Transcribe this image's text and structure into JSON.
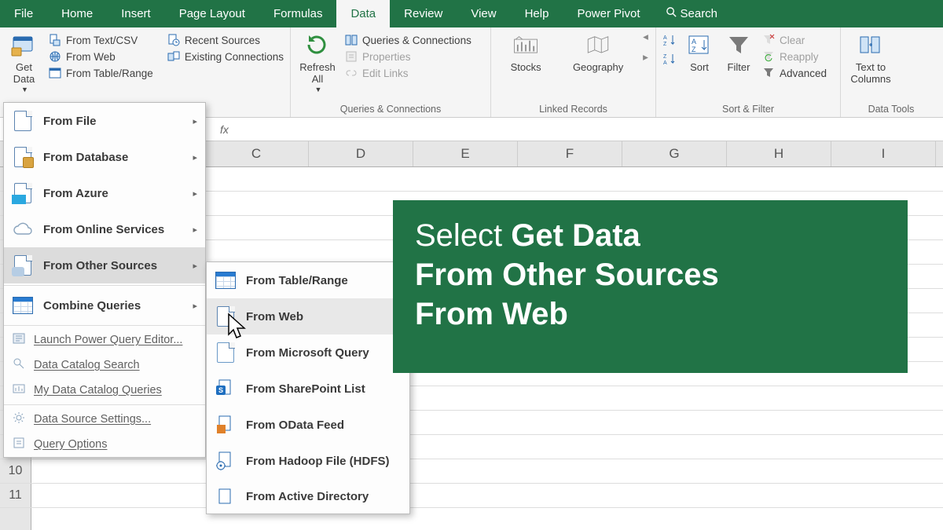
{
  "tabs": [
    "File",
    "Home",
    "Insert",
    "Page Layout",
    "Formulas",
    "Data",
    "Review",
    "View",
    "Help",
    "Power Pivot"
  ],
  "active_tab": "Data",
  "search_label": "Search",
  "ribbon": {
    "get_data": {
      "label": "Get\nData"
    },
    "gt_group": {
      "from_text_csv": "From Text/CSV",
      "from_web": "From Web",
      "from_table_range": "From Table/Range",
      "recent_sources": "Recent Sources",
      "existing_connections": "Existing Connections"
    },
    "refresh_all": {
      "label": "Refresh\nAll"
    },
    "qc_group": {
      "queries_connections": "Queries & Connections",
      "properties": "Properties",
      "edit_links": "Edit Links",
      "label": "Queries & Connections"
    },
    "linked": {
      "stocks": "Stocks",
      "geography": "Geography",
      "label": "Linked Records"
    },
    "sortfilter": {
      "az": "A→Z",
      "za": "Z→A",
      "sort": "Sort",
      "filter": "Filter",
      "clear": "Clear",
      "reapply": "Reapply",
      "advanced": "Advanced",
      "label": "Sort & Filter"
    },
    "datatools": {
      "text_to_columns": "Text to\nColumns",
      "label": "Data Tools"
    }
  },
  "formula_bar": {
    "fx": "fx"
  },
  "columns": [
    "C",
    "D",
    "E",
    "F",
    "G",
    "H",
    "I"
  ],
  "row_numbers_visible": [
    "10",
    "11"
  ],
  "menu_getdata": {
    "from_file": "From File",
    "from_database": "From Database",
    "from_azure": "From Azure",
    "from_online_services": "From Online Services",
    "from_other_sources": "From Other Sources",
    "combine_queries": "Combine Queries",
    "launch_pq_editor": "Launch Power Query Editor...",
    "data_catalog_search": "Data Catalog Search",
    "my_data_catalog_queries": "My Data Catalog Queries",
    "data_source_settings": "Data Source Settings...",
    "query_options": "Query Options"
  },
  "menu_other_sources": {
    "from_table_range": "From Table/Range",
    "from_web": "From Web",
    "from_ms_query": "From Microsoft Query",
    "from_sharepoint_list": "From SharePoint List",
    "from_odata_feed": "From OData Feed",
    "from_hadoop": "From Hadoop File (HDFS)",
    "from_active_directory": "From Active Directory"
  },
  "callout": {
    "line1_a": "Select ",
    "line1_b": "Get Data",
    "line2": "From Other Sources",
    "line3": "From Web"
  }
}
